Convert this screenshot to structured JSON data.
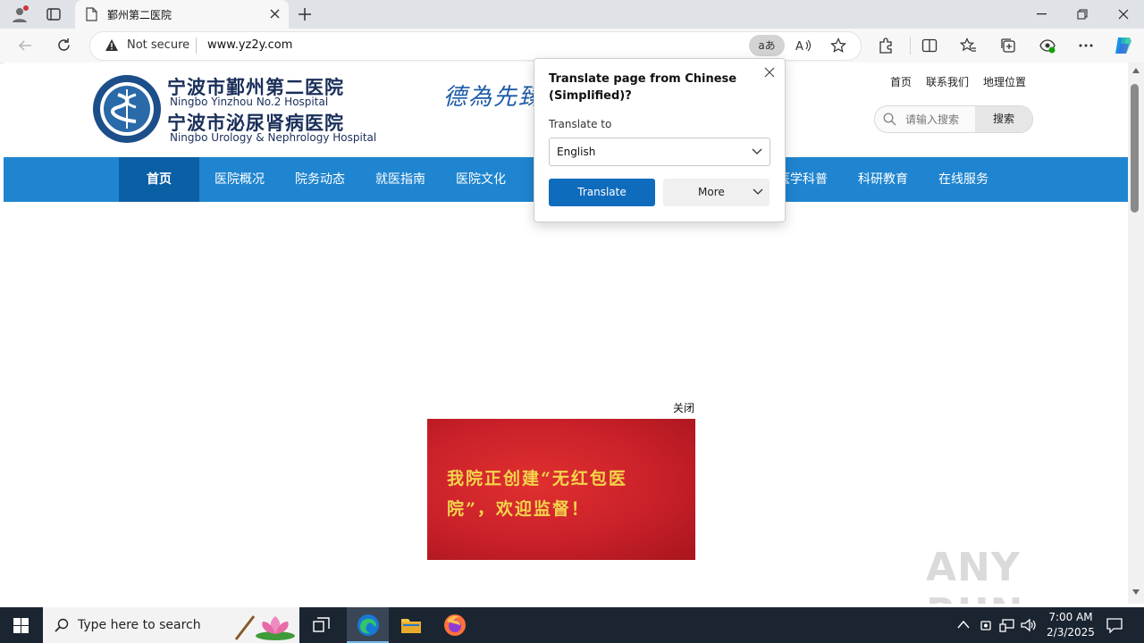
{
  "browser": {
    "tab_title": "鄞州第二医院",
    "security_label": "Not secure",
    "url": "www.yz2y.com",
    "translate_badge": "aあ"
  },
  "site": {
    "name_cn_1": "宁波市鄞州第二医院",
    "name_en_1": "Ningbo Yinzhou No.2 Hospital",
    "name_cn_2": "宁波市泌尿肾病医院",
    "name_en_2": "Ningbo Urology & Nephrology Hospital",
    "slogan": "德為先臻",
    "top_links": [
      "首页",
      "联系我们",
      "地理位置"
    ],
    "search_placeholder": "请输入搜索",
    "search_button": "搜索",
    "nav": [
      "首页",
      "医院概况",
      "院务动态",
      "就医指南",
      "医院文化",
      "医学科普",
      "科研教育",
      "在线服务"
    ],
    "popup_close": "关闭",
    "banner_text_line1": "我院正创建“无红包医",
    "banner_text_line2": "院”，欢迎监督！",
    "colors": {
      "nav_bg": "#1f85d0",
      "nav_active": "#0b5fa5",
      "banner_red": "#c9202a",
      "banner_text": "#f3d54b"
    }
  },
  "translate_popup": {
    "title": "Translate page from Chinese (Simplified)?",
    "translate_to_label": "Translate to",
    "language": "English",
    "translate_button": "Translate",
    "more_button": "More"
  },
  "taskbar": {
    "search_placeholder": "Type here to search",
    "time": "7:00 AM",
    "date": "2/3/2025"
  },
  "watermark": "ANY RUN"
}
